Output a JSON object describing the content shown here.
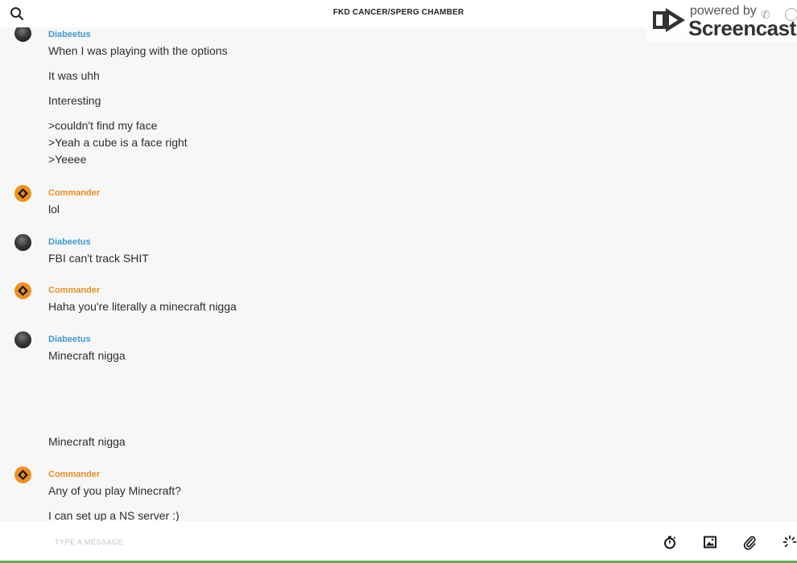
{
  "header": {
    "title": "FKD CANCER/SPERG CHAMBER",
    "search_icon": "search-icon"
  },
  "watermark": {
    "powered": "powered by",
    "brand": "Screencastify"
  },
  "colors": {
    "diabeetus": "#3e9ad1",
    "commander": "#e98f22",
    "avatar_orange": "#f0901e",
    "background": "#f7f7f7"
  },
  "messages": [
    {
      "sender": "Diabeetus",
      "avatar": "dark-avatar",
      "lines": [
        "When I was playing with the options",
        "It was uhh",
        "Interesting",
        ">couldn't find my face",
        ">Yeah a cube is a face right",
        ">Yeeee"
      ]
    },
    {
      "sender": "Commander",
      "avatar": "diamond-avatar",
      "lines": [
        "lol"
      ]
    },
    {
      "sender": "Diabeetus",
      "avatar": "dark-avatar",
      "lines": [
        "FBI can't track SHIT"
      ]
    },
    {
      "sender": "Commander",
      "avatar": "diamond-avatar",
      "lines": [
        "Haha you're literally a minecraft nigga"
      ]
    },
    {
      "sender": "Diabeetus",
      "avatar": "dark-avatar",
      "lines": [
        "Minecraft nigga",
        "Minecraft nigga"
      ]
    },
    {
      "sender": "Commander",
      "avatar": "diamond-avatar",
      "lines": [
        "Any of you play Minecraft?",
        "I can set up a NS server :)"
      ]
    }
  ],
  "composer": {
    "placeholder": "TYPE A MESSAGE",
    "icons": [
      "timer-icon",
      "image-icon",
      "paperclip-icon",
      "loading-icon"
    ]
  }
}
